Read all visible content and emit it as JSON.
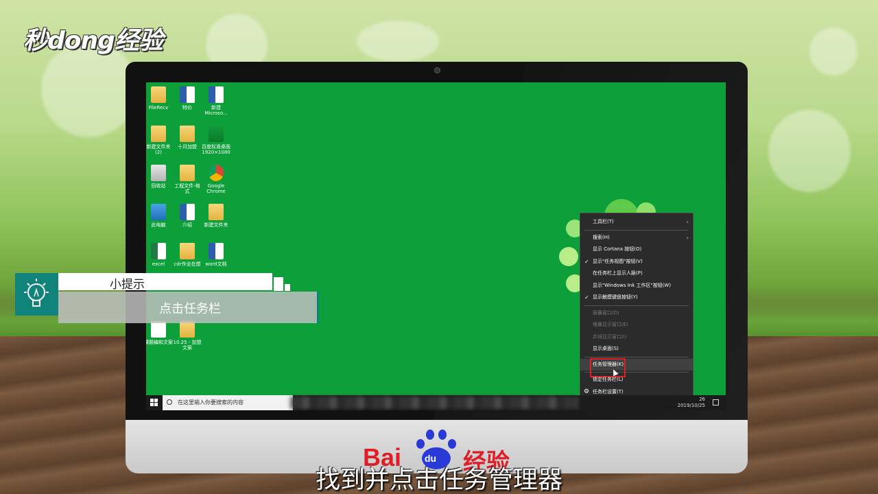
{
  "brand_logo": "秒dong经验",
  "desktop": {
    "icons": [
      {
        "label": "FileRecv",
        "type": "folder"
      },
      {
        "label": "特价",
        "type": "word"
      },
      {
        "label": "新建 Microso...",
        "type": "word"
      },
      {
        "label": "新建文件夹 (2)",
        "type": "folder"
      },
      {
        "label": "十月加盟",
        "type": "folder"
      },
      {
        "label": "百度标准桌面 1920×1080",
        "type": "green"
      },
      {
        "label": "回收站",
        "type": "bin"
      },
      {
        "label": "工程文件-格 式",
        "type": "folder"
      },
      {
        "label": "Google Chrome",
        "type": "chrome"
      },
      {
        "label": "此电脑",
        "type": "pc"
      },
      {
        "label": "介绍",
        "type": "word"
      },
      {
        "label": "新建文件夹",
        "type": "folder"
      },
      {
        "label": "excel",
        "type": "excel"
      },
      {
        "label": "cdr作业在想",
        "type": "folder"
      },
      {
        "label": "word文档",
        "type": "word"
      },
      {
        "label": "课题编和文案",
        "type": "file"
      },
      {
        "label": "10.25 - 加盟 文案",
        "type": "folder"
      }
    ]
  },
  "context_menu": {
    "items": [
      {
        "label": "工具栏(T)",
        "submenu": true,
        "checked": false,
        "disabled": false
      },
      {
        "sep": true
      },
      {
        "label": "搜索(H)",
        "submenu": true,
        "checked": false,
        "disabled": false
      },
      {
        "label": "显示 Cortana 按钮(O)",
        "submenu": false,
        "checked": false,
        "disabled": false
      },
      {
        "label": "显示\"任务视图\"按钮(V)",
        "submenu": false,
        "checked": true,
        "disabled": false
      },
      {
        "label": "在任务栏上显示人脉(P)",
        "submenu": false,
        "checked": false,
        "disabled": false
      },
      {
        "label": "显示\"Windows Ink 工作区\"按钮(W)",
        "submenu": false,
        "checked": false,
        "disabled": false
      },
      {
        "label": "显示触摸键盘按钮(Y)",
        "submenu": false,
        "checked": true,
        "disabled": false
      },
      {
        "sep": true
      },
      {
        "label": "层叠窗口(D)",
        "submenu": false,
        "checked": false,
        "disabled": true
      },
      {
        "label": "堆叠显示窗口(E)",
        "submenu": false,
        "checked": false,
        "disabled": true
      },
      {
        "label": "并排显示窗口(I)",
        "submenu": false,
        "checked": false,
        "disabled": true
      },
      {
        "label": "显示桌面(S)",
        "submenu": false,
        "checked": false,
        "disabled": false
      },
      {
        "sep": true
      },
      {
        "label": "任务管理器(K)",
        "submenu": false,
        "checked": false,
        "disabled": false,
        "highlighted": true
      },
      {
        "sep": true
      },
      {
        "label": "锁定任务栏(L)",
        "submenu": false,
        "checked": false,
        "disabled": false
      },
      {
        "label": "任务栏设置(T)",
        "submenu": false,
        "checked": false,
        "disabled": false,
        "gear": true
      }
    ]
  },
  "taskbar": {
    "search_placeholder": "在这里输入你要搜索的内容",
    "time_partial": "26",
    "date": "2019/10/25"
  },
  "tip": {
    "title": "小提示",
    "text": "点击任务栏"
  },
  "monitor_brand": {
    "left": "Bai",
    "paw": "du",
    "right": "经验"
  },
  "subtitle": "找到并点击任务管理器",
  "colors": {
    "desktop_green": "#0da03a",
    "tip_teal": "#10837b",
    "highlight_red": "#e02020",
    "baidu_red": "#de1f27",
    "baidu_blue": "#2a3ad6"
  }
}
